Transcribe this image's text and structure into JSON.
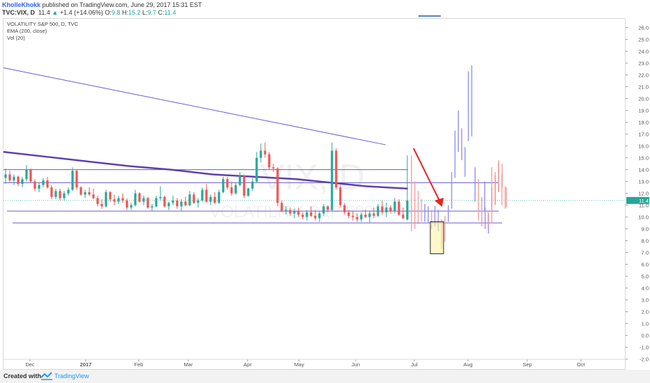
{
  "header": {
    "author": "KholleKhokk",
    "published": "published on TradingView.com, June 29, 2017 15:31 EST",
    "symbol": "TVC:VIX, D",
    "last": "11.4",
    "change": "+1.4 (+14.06%)",
    "o_label": "O:",
    "o_value": "9.8",
    "h_label": "H:",
    "h_value": "15.2",
    "l_label": "L:",
    "l_value": "9.7",
    "c_label": "C:",
    "c_value": "11.4"
  },
  "legend": {
    "line1": "VOLATILITY S&P 500, D, TVC",
    "line2": "EMA (200, close)",
    "line3": "Vol (20)"
  },
  "watermark": {
    "big": "VIX, D",
    "small": "VOLATILITY S&P 500"
  },
  "footer": {
    "created": "Created with",
    "brand": "TradingView"
  },
  "colors": {
    "up": "#26a69a",
    "down": "#ef5350",
    "ema": "#5e3fae",
    "trend": "#6a5acd",
    "arrow": "#e52525",
    "ghost_up": "#8c8cf0",
    "ghost_down": "#f29a9a",
    "price_tag": "#26a69a"
  },
  "chart_data": {
    "type": "candlestick",
    "ylim": [
      -2.9,
      26.8
    ],
    "y_ticks": [
      -2.0,
      -1.0,
      0.0,
      1.0,
      2.0,
      3.0,
      4.0,
      5.0,
      6.0,
      7.0,
      8.0,
      9.0,
      10.0,
      11.0,
      12.0,
      13.0,
      14.0,
      15.0,
      16.0,
      17.0,
      18.0,
      19.0,
      20.0,
      21.0,
      22.0,
      23.0,
      24.0,
      25.0,
      26.0
    ],
    "x_ticks": [
      "Dec",
      "2017",
      "Feb",
      "Mar",
      "Apr",
      "May",
      "Jun",
      "Jul",
      "Aug",
      "Sep",
      "Oct"
    ],
    "last_price": "11.4",
    "ema200": [
      [
        0,
        15.5
      ],
      [
        60,
        15.1
      ],
      [
        120,
        14.7
      ],
      [
        180,
        14.3
      ],
      [
        240,
        14.0
      ],
      [
        300,
        13.6
      ],
      [
        360,
        13.4
      ],
      [
        420,
        13.2
      ],
      [
        470,
        12.9
      ],
      [
        520,
        12.6
      ],
      [
        580,
        12.4
      ]
    ],
    "horizontal_levels": [
      12.9,
      14.0,
      10.5,
      9.5
    ],
    "downtrend_line": [
      [
        0,
        22.6
      ],
      [
        550,
        16.1
      ]
    ],
    "candles": [
      {
        "o": 13.3,
        "h": 14.1,
        "l": 12.8,
        "c": 13.6
      },
      {
        "o": 13.6,
        "h": 13.9,
        "l": 12.9,
        "c": 13.1
      },
      {
        "o": 13.1,
        "h": 13.6,
        "l": 12.7,
        "c": 13.4
      },
      {
        "o": 13.4,
        "h": 13.5,
        "l": 12.6,
        "c": 12.8
      },
      {
        "o": 12.8,
        "h": 13.4,
        "l": 12.5,
        "c": 13.2
      },
      {
        "o": 13.2,
        "h": 14.4,
        "l": 13.0,
        "c": 14.0
      },
      {
        "o": 14.0,
        "h": 14.1,
        "l": 12.9,
        "c": 13.0
      },
      {
        "o": 13.0,
        "h": 13.2,
        "l": 12.2,
        "c": 12.4
      },
      {
        "o": 12.4,
        "h": 12.9,
        "l": 12.1,
        "c": 12.7
      },
      {
        "o": 12.7,
        "h": 13.3,
        "l": 12.5,
        "c": 13.1
      },
      {
        "o": 13.1,
        "h": 13.4,
        "l": 12.4,
        "c": 12.5
      },
      {
        "o": 12.5,
        "h": 12.7,
        "l": 11.5,
        "c": 11.7
      },
      {
        "o": 11.7,
        "h": 12.4,
        "l": 11.5,
        "c": 12.2
      },
      {
        "o": 12.2,
        "h": 12.4,
        "l": 11.4,
        "c": 11.6
      },
      {
        "o": 11.6,
        "h": 12.2,
        "l": 11.4,
        "c": 12.0
      },
      {
        "o": 12.0,
        "h": 12.5,
        "l": 11.8,
        "c": 12.3
      },
      {
        "o": 12.3,
        "h": 14.2,
        "l": 12.2,
        "c": 13.9
      },
      {
        "o": 13.9,
        "h": 14.0,
        "l": 12.3,
        "c": 12.5
      },
      {
        "o": 12.5,
        "h": 12.6,
        "l": 11.8,
        "c": 11.9
      },
      {
        "o": 11.9,
        "h": 12.3,
        "l": 11.6,
        "c": 12.1
      },
      {
        "o": 12.1,
        "h": 12.5,
        "l": 11.8,
        "c": 11.9
      },
      {
        "o": 11.9,
        "h": 12.4,
        "l": 11.5,
        "c": 11.6
      },
      {
        "o": 11.6,
        "h": 11.8,
        "l": 10.9,
        "c": 11.1
      },
      {
        "o": 11.1,
        "h": 11.5,
        "l": 10.7,
        "c": 10.9
      },
      {
        "o": 10.9,
        "h": 12.3,
        "l": 10.8,
        "c": 12.1
      },
      {
        "o": 12.1,
        "h": 12.2,
        "l": 11.3,
        "c": 11.5
      },
      {
        "o": 11.5,
        "h": 11.9,
        "l": 11.0,
        "c": 11.3
      },
      {
        "o": 11.3,
        "h": 11.8,
        "l": 11.1,
        "c": 11.6
      },
      {
        "o": 11.6,
        "h": 12.0,
        "l": 11.2,
        "c": 11.4
      },
      {
        "o": 11.4,
        "h": 11.6,
        "l": 10.6,
        "c": 10.8
      },
      {
        "o": 10.8,
        "h": 11.2,
        "l": 10.6,
        "c": 11.0
      },
      {
        "o": 11.0,
        "h": 12.3,
        "l": 10.9,
        "c": 12.0
      },
      {
        "o": 12.0,
        "h": 12.1,
        "l": 11.2,
        "c": 11.3
      },
      {
        "o": 11.3,
        "h": 11.8,
        "l": 11.0,
        "c": 11.6
      },
      {
        "o": 11.6,
        "h": 11.7,
        "l": 10.7,
        "c": 10.8
      },
      {
        "o": 10.8,
        "h": 11.1,
        "l": 10.5,
        "c": 10.9
      },
      {
        "o": 10.9,
        "h": 11.8,
        "l": 10.8,
        "c": 11.6
      },
      {
        "o": 11.6,
        "h": 12.6,
        "l": 11.4,
        "c": 11.7
      },
      {
        "o": 11.7,
        "h": 11.8,
        "l": 10.8,
        "c": 10.9
      },
      {
        "o": 10.9,
        "h": 11.3,
        "l": 10.6,
        "c": 11.2
      },
      {
        "o": 11.2,
        "h": 11.8,
        "l": 11.0,
        "c": 11.4
      },
      {
        "o": 11.4,
        "h": 11.6,
        "l": 10.7,
        "c": 10.9
      },
      {
        "o": 10.9,
        "h": 11.5,
        "l": 10.5,
        "c": 11.3
      },
      {
        "o": 11.3,
        "h": 11.7,
        "l": 10.9,
        "c": 11.0
      },
      {
        "o": 11.0,
        "h": 12.2,
        "l": 10.9,
        "c": 11.9
      },
      {
        "o": 11.9,
        "h": 12.1,
        "l": 11.1,
        "c": 11.2
      },
      {
        "o": 11.2,
        "h": 11.6,
        "l": 10.8,
        "c": 11.4
      },
      {
        "o": 11.4,
        "h": 12.5,
        "l": 11.3,
        "c": 12.3
      },
      {
        "o": 12.3,
        "h": 12.8,
        "l": 11.2,
        "c": 11.3
      },
      {
        "o": 11.3,
        "h": 11.9,
        "l": 11.0,
        "c": 11.7
      },
      {
        "o": 11.7,
        "h": 12.1,
        "l": 11.1,
        "c": 11.2
      },
      {
        "o": 11.2,
        "h": 12.3,
        "l": 11.1,
        "c": 12.1
      },
      {
        "o": 12.1,
        "h": 13.4,
        "l": 12.0,
        "c": 13.2
      },
      {
        "o": 13.2,
        "h": 13.4,
        "l": 12.3,
        "c": 12.5
      },
      {
        "o": 12.5,
        "h": 13.0,
        "l": 11.8,
        "c": 12.0
      },
      {
        "o": 12.0,
        "h": 12.9,
        "l": 11.9,
        "c": 12.7
      },
      {
        "o": 12.7,
        "h": 13.8,
        "l": 12.6,
        "c": 13.5
      },
      {
        "o": 13.5,
        "h": 13.6,
        "l": 11.6,
        "c": 11.8
      },
      {
        "o": 11.8,
        "h": 12.5,
        "l": 11.7,
        "c": 12.4
      },
      {
        "o": 12.4,
        "h": 13.3,
        "l": 12.2,
        "c": 13.0
      },
      {
        "o": 13.0,
        "h": 15.5,
        "l": 12.9,
        "c": 15.0
      },
      {
        "o": 15.0,
        "h": 16.2,
        "l": 14.6,
        "c": 15.6
      },
      {
        "o": 15.6,
        "h": 16.3,
        "l": 15.0,
        "c": 15.3
      },
      {
        "o": 15.3,
        "h": 15.5,
        "l": 14.0,
        "c": 14.2
      },
      {
        "o": 14.2,
        "h": 14.5,
        "l": 13.8,
        "c": 14.1
      },
      {
        "o": 14.1,
        "h": 14.2,
        "l": 10.9,
        "c": 11.2
      },
      {
        "o": 11.2,
        "h": 11.4,
        "l": 10.4,
        "c": 10.5
      },
      {
        "o": 10.5,
        "h": 10.9,
        "l": 10.2,
        "c": 10.6
      },
      {
        "o": 10.6,
        "h": 10.8,
        "l": 10.1,
        "c": 10.3
      },
      {
        "o": 10.3,
        "h": 10.7,
        "l": 9.9,
        "c": 10.5
      },
      {
        "o": 10.5,
        "h": 10.8,
        "l": 10.0,
        "c": 10.2
      },
      {
        "o": 10.2,
        "h": 10.4,
        "l": 9.8,
        "c": 10.0
      },
      {
        "o": 10.0,
        "h": 10.6,
        "l": 9.7,
        "c": 10.4
      },
      {
        "o": 10.4,
        "h": 10.9,
        "l": 10.0,
        "c": 10.1
      },
      {
        "o": 10.1,
        "h": 10.6,
        "l": 9.7,
        "c": 9.9
      },
      {
        "o": 9.9,
        "h": 10.5,
        "l": 9.6,
        "c": 10.3
      },
      {
        "o": 10.3,
        "h": 11.1,
        "l": 10.1,
        "c": 10.9
      },
      {
        "o": 10.9,
        "h": 11.0,
        "l": 10.4,
        "c": 10.6
      },
      {
        "o": 10.6,
        "h": 16.3,
        "l": 10.5,
        "c": 15.6
      },
      {
        "o": 15.6,
        "h": 15.8,
        "l": 12.3,
        "c": 12.5
      },
      {
        "o": 12.5,
        "h": 12.7,
        "l": 10.8,
        "c": 11.0
      },
      {
        "o": 11.0,
        "h": 11.2,
        "l": 10.2,
        "c": 10.4
      },
      {
        "o": 10.4,
        "h": 10.6,
        "l": 9.9,
        "c": 10.1
      },
      {
        "o": 10.1,
        "h": 10.5,
        "l": 9.7,
        "c": 10.0
      },
      {
        "o": 10.0,
        "h": 10.3,
        "l": 9.6,
        "c": 9.8
      },
      {
        "o": 9.8,
        "h": 10.4,
        "l": 9.6,
        "c": 10.2
      },
      {
        "o": 10.2,
        "h": 10.6,
        "l": 9.9,
        "c": 10.0
      },
      {
        "o": 10.0,
        "h": 10.5,
        "l": 9.5,
        "c": 10.3
      },
      {
        "o": 10.3,
        "h": 10.8,
        "l": 9.9,
        "c": 10.1
      },
      {
        "o": 10.1,
        "h": 11.1,
        "l": 10.0,
        "c": 10.9
      },
      {
        "o": 10.9,
        "h": 11.4,
        "l": 10.2,
        "c": 10.4
      },
      {
        "o": 10.4,
        "h": 11.2,
        "l": 10.0,
        "c": 10.8
      },
      {
        "o": 10.8,
        "h": 11.0,
        "l": 10.3,
        "c": 10.5
      },
      {
        "o": 10.5,
        "h": 11.6,
        "l": 10.3,
        "c": 11.3
      },
      {
        "o": 11.3,
        "h": 11.5,
        "l": 10.1,
        "c": 10.2
      },
      {
        "o": 10.2,
        "h": 10.8,
        "l": 9.8,
        "c": 9.9
      },
      {
        "o": 9.8,
        "h": 15.2,
        "l": 9.7,
        "c": 11.4
      }
    ],
    "projection": [
      {
        "d": "down",
        "h": 15.2,
        "l": 8.8
      },
      {
        "d": "down",
        "h": 13.0,
        "l": 9.0
      },
      {
        "d": "down",
        "h": 12.2,
        "l": 9.4
      },
      {
        "d": "down",
        "h": 11.5,
        "l": 9.6
      },
      {
        "d": "up",
        "h": 11.1,
        "l": 9.6
      },
      {
        "d": "up",
        "h": 10.9,
        "l": 9.5
      },
      {
        "d": "down",
        "h": 10.6,
        "l": 9.0
      },
      {
        "d": "up",
        "h": 10.9,
        "l": 9.2
      },
      {
        "d": "up",
        "h": 10.6,
        "l": 8.8
      },
      {
        "d": "down",
        "h": 9.8,
        "l": 7.3
      },
      {
        "d": "down",
        "h": 10.1,
        "l": 7.9
      },
      {
        "d": "up",
        "h": 11.0,
        "l": 9.6
      },
      {
        "d": "up",
        "h": 13.8,
        "l": 10.7
      },
      {
        "d": "up",
        "h": 17.3,
        "l": 13.3
      },
      {
        "d": "up",
        "h": 19.0,
        "l": 15.5
      },
      {
        "d": "up",
        "h": 17.5,
        "l": 14.8
      },
      {
        "d": "up",
        "h": 15.9,
        "l": 13.4
      },
      {
        "d": "up",
        "h": 22.3,
        "l": 16.4
      },
      {
        "d": "up",
        "h": 22.8,
        "l": 16.8
      },
      {
        "d": "up",
        "h": 14.2,
        "l": 11.3
      },
      {
        "d": "down",
        "h": 13.2,
        "l": 9.7
      },
      {
        "d": "down",
        "h": 11.7,
        "l": 9.2
      },
      {
        "d": "up",
        "h": 10.8,
        "l": 9.0
      },
      {
        "d": "up",
        "h": 10.3,
        "l": 8.6
      },
      {
        "d": "down",
        "h": 12.5,
        "l": 9.5
      },
      {
        "d": "down",
        "h": 13.8,
        "l": 11.1
      },
      {
        "d": "down",
        "h": 14.6,
        "l": 12.1
      },
      {
        "d": "down",
        "h": 13.6,
        "l": 11.0
      },
      {
        "d": "down",
        "h": 12.6,
        "l": 10.7
      }
    ]
  }
}
